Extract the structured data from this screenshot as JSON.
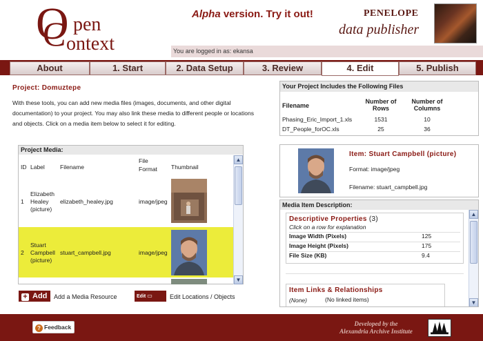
{
  "header": {
    "logo_open": "pen",
    "logo_context": "ontext",
    "alpha_word": "Alpha",
    "alpha_rest": " version. Try it out!",
    "penelope_title": "PENELOPE",
    "penelope_sub": "data publisher",
    "login_text": "You are logged in as: ekansa"
  },
  "tabs": [
    {
      "label": "About",
      "active": false
    },
    {
      "label": "1. Start",
      "active": false
    },
    {
      "label": "2. Data Setup",
      "active": false
    },
    {
      "label": "3. Review",
      "active": false
    },
    {
      "label": "4. Edit",
      "active": true
    },
    {
      "label": "5. Publish",
      "active": false
    }
  ],
  "project": {
    "title": "Project: Domuztepe",
    "intro": "With these tools, you can add new media files (images, documents, and other digital documentation) to your project. You may also link these media to different people or locations and objects. Click on a media item below to select it for editing."
  },
  "media": {
    "panel_title": "Project Media:",
    "columns": {
      "id": "ID",
      "label": "Label",
      "filename": "Filename",
      "format": "File Format",
      "thumb": "Thumbnail"
    },
    "rows": [
      {
        "id": "1",
        "label": "Elizabeth Healey (picture)",
        "filename": "elizabeth_healey.jpg",
        "format": "image/jpeg",
        "selected": false
      },
      {
        "id": "2",
        "label": "Stuart Campbell (picture)",
        "filename": "stuart_campbell.jpg",
        "format": "image/jpeg",
        "selected": true
      }
    ],
    "add_button": "Add",
    "add_label": "Add a Media Resource",
    "edit_button": "Edit",
    "edit_label": "Edit Locations / Objects"
  },
  "files": {
    "panel_title": "Your Project Includes the Following Files",
    "headers": {
      "filename": "Filename",
      "rows": "Number of Rows",
      "cols": "Number of Columns"
    },
    "rows": [
      {
        "filename": "Phasing_Eric_Import_1.xls",
        "rows": "1531",
        "cols": "10"
      },
      {
        "filename": "DT_People_forOC.xls",
        "rows": "25",
        "cols": "36"
      }
    ]
  },
  "item": {
    "title": "Item: Stuart Campbell (picture)",
    "format": "Format: image/jpeg",
    "filename": "Filename: stuart_campbell.jpg"
  },
  "description": {
    "panel_title": "Media Item Description:",
    "props_title": "Descriptive Properties",
    "props_count": "(3)",
    "hint": "Click on a row for explanation",
    "props": [
      {
        "name": "Image Width (Pixels)",
        "value": "125"
      },
      {
        "name": "Image Height (Pixels)",
        "value": "175"
      },
      {
        "name": "File Size (KB)",
        "value": "9.4"
      }
    ],
    "links_title": "Item Links & Relationships",
    "links_none": "(None)",
    "links_none_text": "(No linked items)"
  },
  "footer": {
    "feedback": "Feedback",
    "developed_line1": "Developed by the",
    "developed_line2": "Alexandria Archive Institute"
  },
  "colors": {
    "brand": "#7a1712",
    "selected_row": "#ecec3a",
    "title_red": "#8a1a14"
  },
  "icons": [
    "plus-icon",
    "edit-icon",
    "feedback-icon",
    "scroll-up-icon",
    "scroll-down-icon"
  ]
}
